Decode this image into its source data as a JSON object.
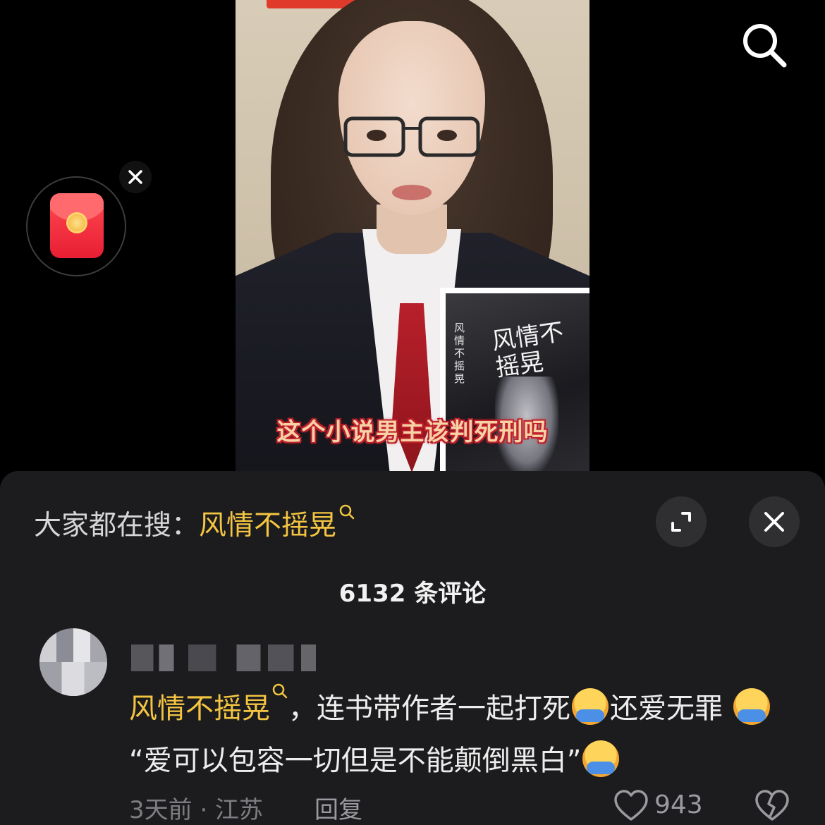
{
  "video": {
    "subtitle": "这个小说男主该判死刑吗",
    "book": {
      "title": "风情不摇晃",
      "spine": "风情不摇晃"
    }
  },
  "overlay": {
    "search_icon": "search-icon",
    "redpacket_icon": "red-packet-icon",
    "close_icon": "close-icon"
  },
  "sheet": {
    "hot_search_prefix": "大家都在搜：",
    "hot_search_keyword": "风情不摇晃",
    "comment_count": "6132 条评论"
  },
  "comment": {
    "keyword": "风情不摇晃",
    "text_part1": "，连书带作者一起打死",
    "text_part2": "还爱无罪",
    "text_part3": "“爱可以包容一切但是不能颠倒黑白”",
    "meta": "3天前 · 江苏",
    "reply_label": "回复",
    "like_count": "943"
  },
  "colors": {
    "background": "#000000",
    "sheet": "#1c1c1e",
    "keyword": "#f4c542",
    "subtitle_fill": "#f7d2a6",
    "subtitle_stroke": "#c01f2b"
  }
}
